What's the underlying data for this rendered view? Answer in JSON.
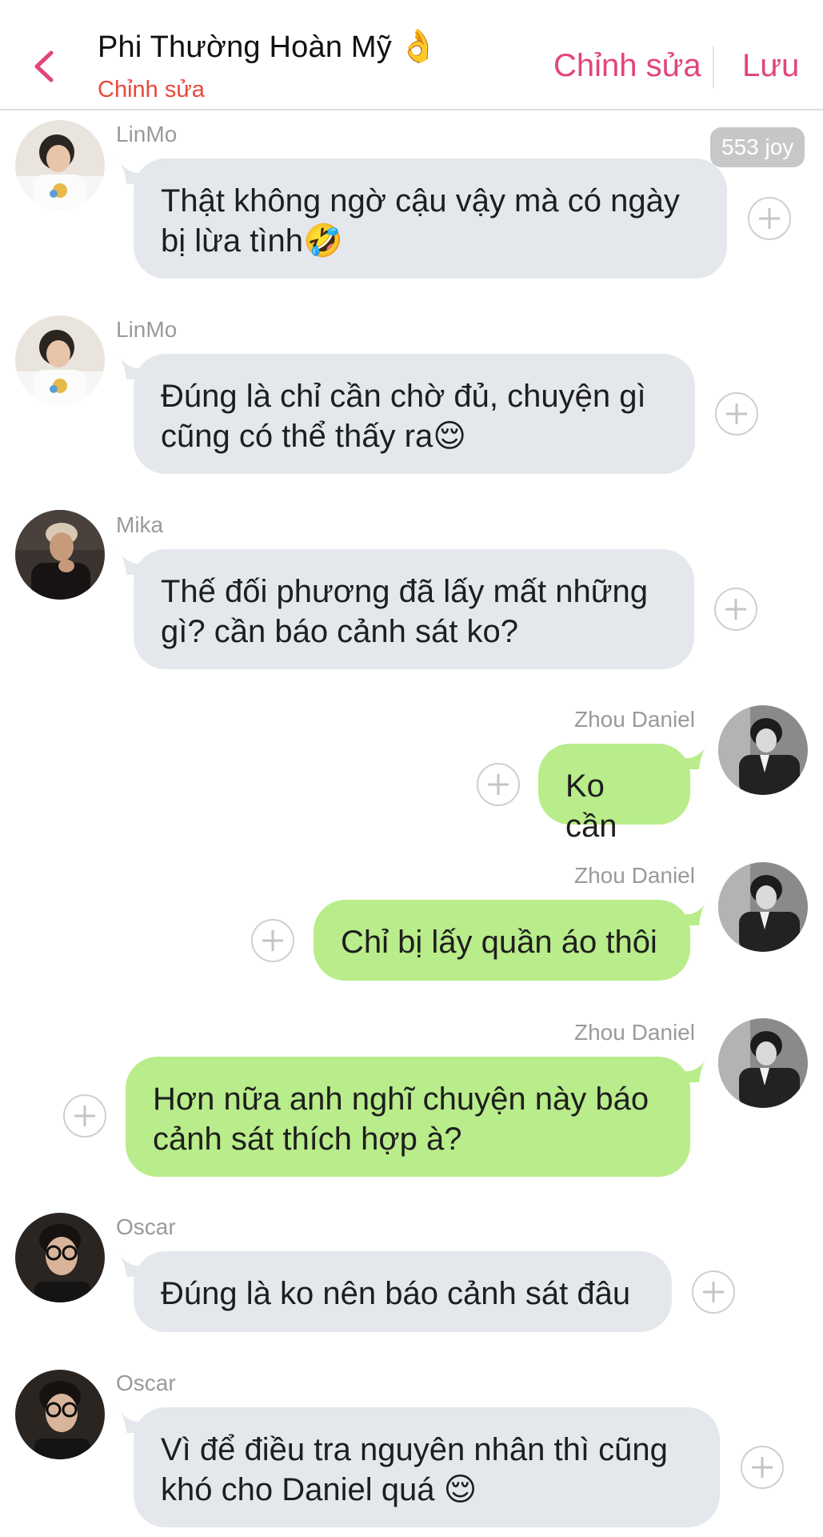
{
  "header": {
    "title": "Phi Thường Hoàn Mỹ",
    "title_emoji": "👌",
    "subtitle": "Chỉnh sửa",
    "edit_label": "Chỉnh sửa",
    "save_label": "Lưu",
    "back_icon": "chevron-left-icon"
  },
  "joy_badge": "553 joy",
  "colors": {
    "accent": "#e2457a",
    "subtitle": "#e8483c",
    "incoming_bubble": "#e4e8ec",
    "outgoing_bubble": "#b9ec8a"
  },
  "messages": [
    {
      "sender": "LinMo",
      "direction": "in",
      "lines": [
        "Thật không ngờ cậu vậy mà có ngày",
        "bị lừa tình🤣"
      ]
    },
    {
      "sender": "LinMo",
      "direction": "in",
      "lines": [
        "Đúng là chỉ cần chờ đủ, chuyện gì",
        "cũng có thể thấy ra😌"
      ]
    },
    {
      "sender": "Mika",
      "direction": "in",
      "lines": [
        "Thế đối phương đã lấy mất những",
        "gì? cần báo cảnh sát ko?"
      ]
    },
    {
      "sender": "Zhou Daniel",
      "direction": "out",
      "lines": [
        "Ko cần"
      ]
    },
    {
      "sender": "Zhou Daniel",
      "direction": "out",
      "lines": [
        "Chỉ bị lấy quần áo thôi"
      ]
    },
    {
      "sender": "Zhou Daniel",
      "direction": "out",
      "lines": [
        "Hơn nữa anh nghĩ chuyện này báo",
        "cảnh sát thích hợp à?"
      ]
    },
    {
      "sender": "Oscar",
      "direction": "in",
      "lines": [
        "Đúng là ko nên báo cảnh sát đâu"
      ]
    },
    {
      "sender": "Oscar",
      "direction": "in",
      "lines": [
        "Vì để điều tra nguyên nhân thì cũng",
        "khó cho Daniel quá 😌"
      ]
    }
  ]
}
